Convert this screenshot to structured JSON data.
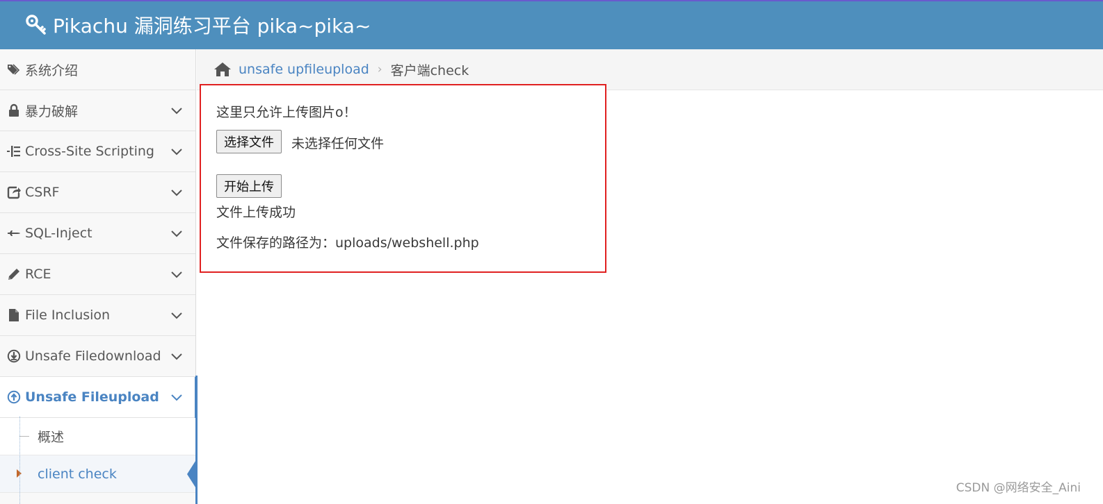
{
  "header": {
    "title": "Pikachu 漏洞练习平台 pika~pika~",
    "icon": "key-icon",
    "bg": "#4e8fbd"
  },
  "sidebar": {
    "items": [
      {
        "label": "系统介绍",
        "icon": "tags-icon",
        "expandable": false
      },
      {
        "label": "暴力破解",
        "icon": "lock-icon",
        "expandable": true
      },
      {
        "label": "Cross-Site Scripting",
        "icon": "list-icon",
        "expandable": true
      },
      {
        "label": "CSRF",
        "icon": "share-icon",
        "expandable": true
      },
      {
        "label": "SQL-Inject",
        "icon": "plane-icon",
        "expandable": true
      },
      {
        "label": "RCE",
        "icon": "pencil-icon",
        "expandable": true
      },
      {
        "label": "File Inclusion",
        "icon": "file-icon",
        "expandable": true
      },
      {
        "label": "Unsafe Filedownload",
        "icon": "download-circle-icon",
        "expandable": true
      },
      {
        "label": "Unsafe Fileupload",
        "icon": "upload-circle-icon",
        "expandable": true,
        "active": true
      }
    ],
    "subitems": [
      {
        "label": "概述"
      },
      {
        "label": "client check",
        "current": true
      }
    ]
  },
  "breadcrumb": {
    "link": "unsafe upfileupload",
    "current": "客户端check"
  },
  "panel": {
    "intro": "这里只允许上传图片o！",
    "choose_button": "选择文件",
    "file_status": "未选择任何文件",
    "upload_button": "开始上传",
    "result": "文件上传成功",
    "saved_path": "文件保存的路径为：uploads/webshell.php"
  },
  "watermark": "CSDN @网络安全_Aini",
  "colors": {
    "accent": "#4a84c2",
    "highlight_border": "#e02020"
  }
}
